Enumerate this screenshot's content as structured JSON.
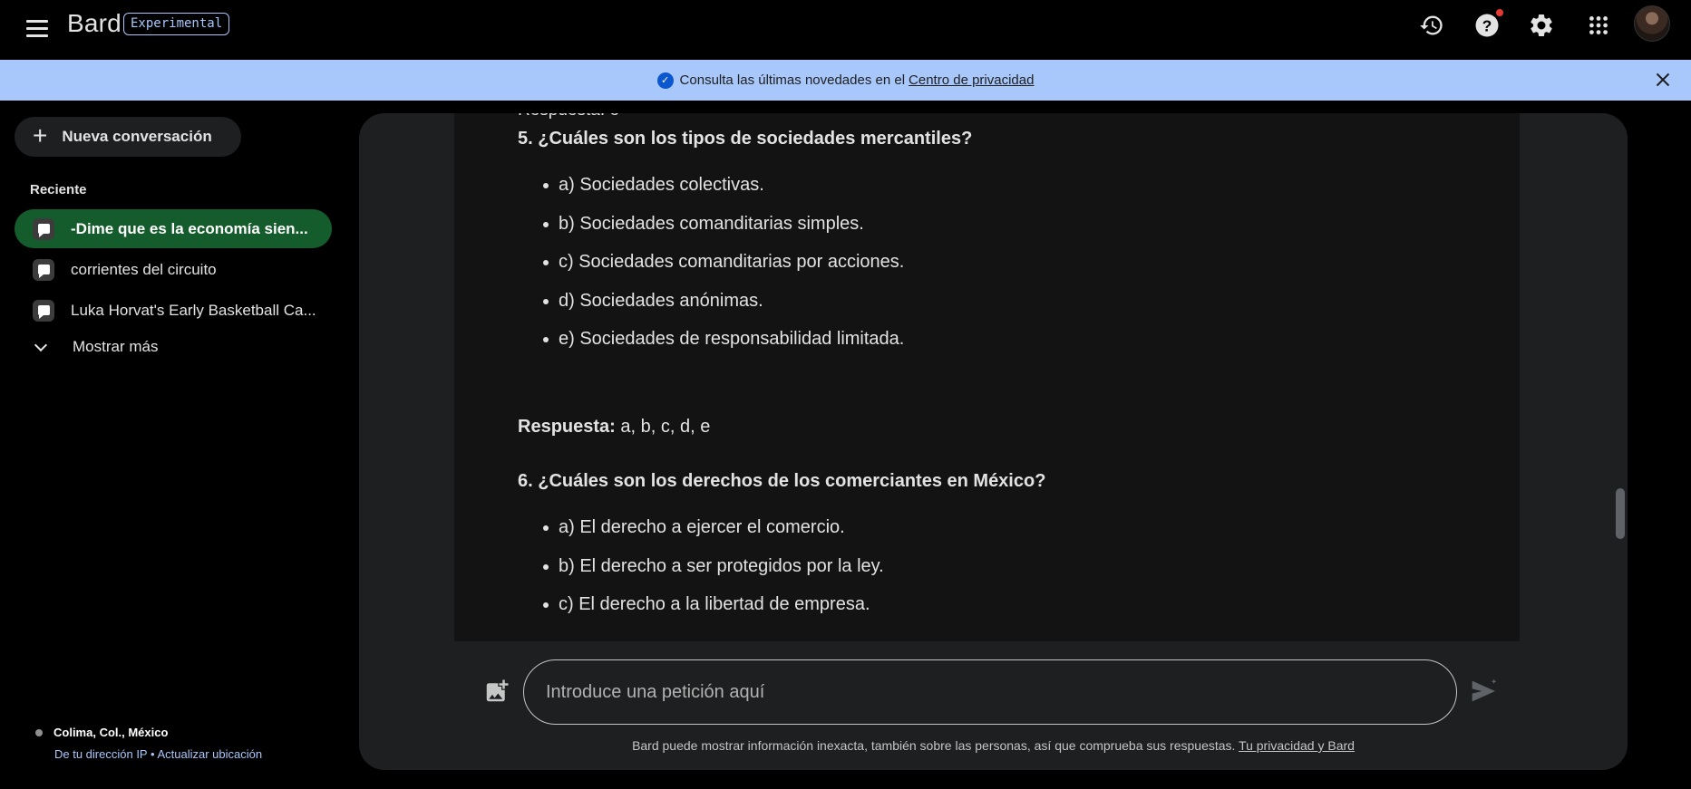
{
  "header": {
    "brand": "Bard",
    "badge": "Experimental",
    "icons": [
      "menu-icon",
      "history-icon",
      "help-icon",
      "settings-icon",
      "apps-grid-icon",
      "avatar"
    ]
  },
  "banner": {
    "text": "Consulta las últimas novedades en el",
    "link": "Centro de privacidad",
    "color": "#a8c7fa"
  },
  "sidebar": {
    "new_chat": "Nueva conversación",
    "recent_title": "Reciente",
    "items": [
      {
        "label": "-Dime que es la economía sien...",
        "active": true
      },
      {
        "label": "corrientes del circuito",
        "active": false
      },
      {
        "label": "Luka Horvat's Early Basketball Ca...",
        "active": false
      }
    ],
    "show_more": "Mostrar más",
    "location": {
      "place": "Colima, Col., México",
      "source": "De tu dirección IP",
      "separator": "•",
      "update": "Actualizar ubicación"
    }
  },
  "response": {
    "cut_text": "Respuesta: e",
    "q5": "5. ¿Cuáles son los tipos de sociedades mercantiles?",
    "q5_options": [
      "a) Sociedades colectivas.",
      "b) Sociedades comanditarias simples.",
      "c) Sociedades comanditarias por acciones.",
      "d) Sociedades anónimas.",
      "e) Sociedades de responsabilidad limitada."
    ],
    "answer_label": "Respuesta:",
    "answer_value": "a, b, c, d, e",
    "q6": "6. ¿Cuáles son los derechos de los comerciantes en México?",
    "q6_options": [
      "a) El derecho a ejercer el comercio.",
      "b) El derecho a ser protegidos por la ley.",
      "c) El derecho a la libertad de empresa."
    ]
  },
  "composer": {
    "placeholder": "Introduce una petición aquí",
    "disclaimer": "Bard puede mostrar información inexacta, también sobre las personas, así que comprueba sus respuestas.",
    "disclaimer_link": "Tu privacidad y Bard"
  }
}
